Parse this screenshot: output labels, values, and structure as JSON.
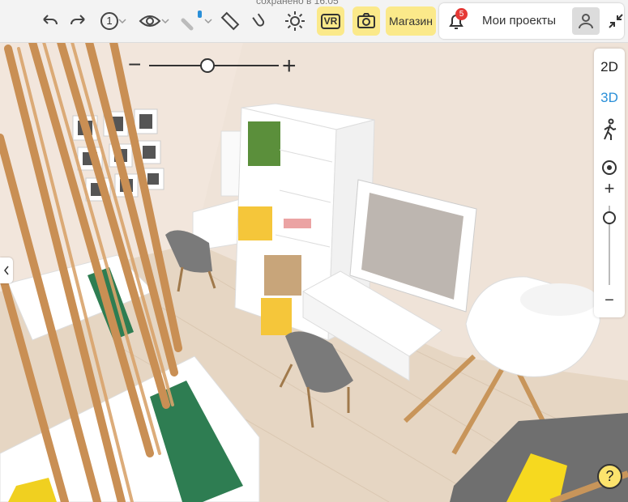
{
  "window": {
    "caption_partial": "сохранено в 16:05"
  },
  "toolbar": {
    "view_level": "1",
    "vr_label": "VR",
    "shop_label": "Магазин",
    "notifications_count": "5",
    "my_projects_label": "Мои проекты",
    "icons": [
      "undo-icon",
      "redo-icon",
      "level-selector-icon",
      "eye-icon",
      "marker-icon",
      "ruler-icon",
      "magnet-icon",
      "sun-icon",
      "vr-icon",
      "camera-icon",
      "bell-icon",
      "user-icon",
      "collapse-icon"
    ]
  },
  "view_panel": {
    "mode_2d": "2D",
    "mode_3d": "3D",
    "active_mode": "3D",
    "zoom_in": "+",
    "zoom_out": "−",
    "zoom_level": 0.1
  },
  "top_slider": {
    "minus": "−",
    "plus": "+",
    "value": 0.45
  },
  "help_label": "?",
  "colors": {
    "accent_yellow": "#fbe98a",
    "active_blue": "#2a8fd8",
    "badge_red": "#e53935",
    "help_yellow": "#fce36d"
  }
}
